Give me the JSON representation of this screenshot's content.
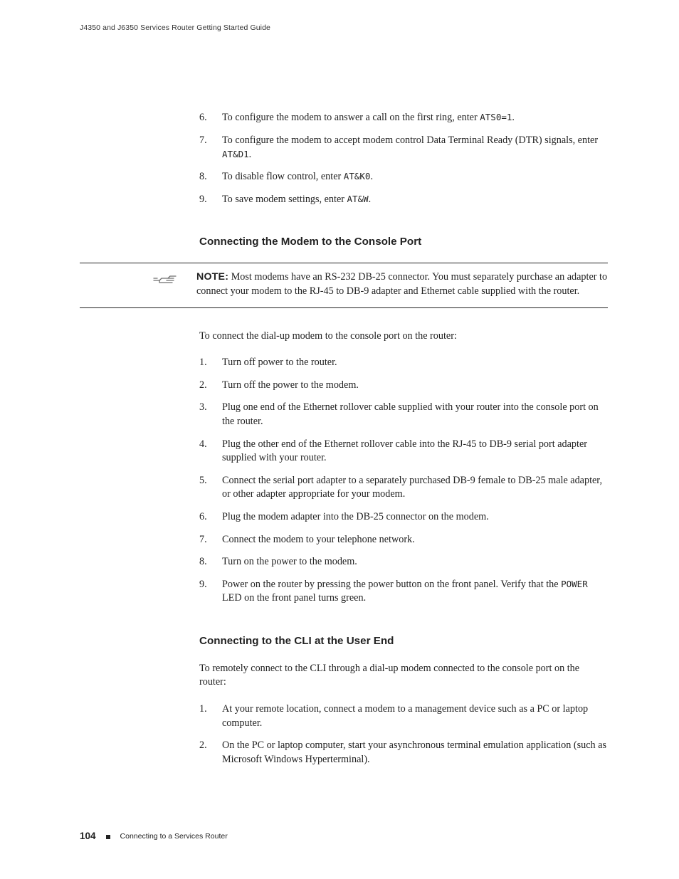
{
  "header": {
    "title": "J4350 and J6350 Services Router Getting Started Guide"
  },
  "section1": {
    "steps": [
      {
        "n": "6.",
        "pre": "To configure the modem to answer a call on the first ring, enter ",
        "code": "ATS0=1",
        "post": "."
      },
      {
        "n": "7.",
        "pre": "To configure the modem to accept modem control Data Terminal Ready (DTR) signals, enter ",
        "code": "AT&D1",
        "post": "."
      },
      {
        "n": "8.",
        "pre": "To disable flow control, enter ",
        "code": "AT&K0",
        "post": "."
      },
      {
        "n": "9.",
        "pre": "To save modem settings, enter ",
        "code": "AT&W",
        "post": "."
      }
    ]
  },
  "section2": {
    "heading": "Connecting the Modem to the Console Port",
    "note_label": "NOTE:",
    "note_body": " Most modems have an RS-232 DB-25 connector. You must separately purchase an adapter to connect your modem to the RJ-45 to DB-9 adapter and Ethernet cable supplied with the router.",
    "intro": "To connect the dial-up modem to the console port on the router:",
    "steps": [
      {
        "n": "1.",
        "text": "Turn off power to the router."
      },
      {
        "n": "2.",
        "text": "Turn off the power to the modem."
      },
      {
        "n": "3.",
        "text": "Plug one end of the Ethernet rollover cable supplied with your router into the console port on the router."
      },
      {
        "n": "4.",
        "text": "Plug the other end of the Ethernet rollover cable into the RJ-45 to DB-9 serial port adapter supplied with your router."
      },
      {
        "n": "5.",
        "text": "Connect the serial port adapter to a separately purchased DB-9 female to DB-25 male adapter, or other adapter appropriate for your modem."
      },
      {
        "n": "6.",
        "text": "Plug the modem adapter into the DB-25 connector on the modem."
      },
      {
        "n": "7.",
        "text": "Connect the modem to your telephone network."
      },
      {
        "n": "8.",
        "text": "Turn on the power to the modem."
      }
    ],
    "step9": {
      "n": "9.",
      "pre": "Power on the router by pressing the power button on the front panel. Verify that the ",
      "code": "POWER",
      "post": " LED on the front panel turns green."
    }
  },
  "section3": {
    "heading": "Connecting to the CLI at the User End",
    "intro": "To remotely connect to the CLI through a dial-up modem connected to the console port on the router:",
    "steps": [
      {
        "n": "1.",
        "text": "At your remote location, connect a modem to a management device such as a PC or laptop computer."
      },
      {
        "n": "2.",
        "text": "On the PC or laptop computer, start your asynchronous terminal emulation application (such as Microsoft Windows Hyperterminal)."
      }
    ]
  },
  "footer": {
    "page_number": "104",
    "section": "Connecting to a Services Router"
  }
}
